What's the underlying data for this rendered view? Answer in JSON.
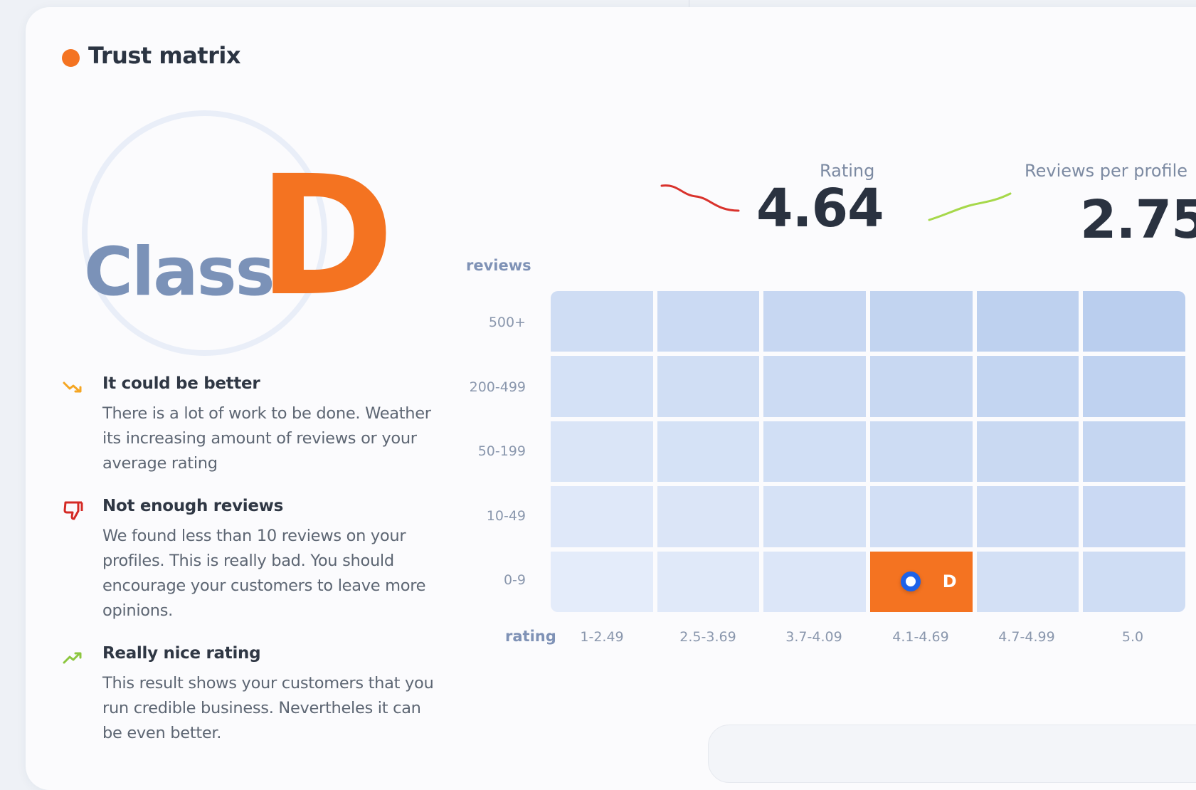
{
  "colors": {
    "accent": "#f47321",
    "class_word": "#7b92b8",
    "trend_down": "#d9322c",
    "trend_up": "#a6d84a",
    "marker": "#1e62e8",
    "grid_base": "#d1def3"
  },
  "title": "Trust matrix",
  "grade": {
    "word": "Class",
    "letter": "D"
  },
  "insights": [
    {
      "icon": "trend-down-icon",
      "title": "It could be better",
      "body": "There is a lot of work to be done. Weather its increasing amount of reviews or your average rating"
    },
    {
      "icon": "thumbs-down-icon",
      "title": "Not enough reviews",
      "body": "We found less than 10 reviews on your profiles. This is really bad. You should encourage your customers to leave more opinions."
    },
    {
      "icon": "trend-up-icon",
      "title": "Really nice rating",
      "body": "This result shows your customers that you run credible business. Nevertheles it can be even better."
    }
  ],
  "metrics": {
    "rating": {
      "label": "Rating",
      "value": "4.64",
      "trend": "down"
    },
    "reviews_per_profile": {
      "label": "Reviews per profile",
      "value": "2.75",
      "trend": "up"
    }
  },
  "matrix": {
    "y_title": "reviews",
    "x_title": "rating",
    "rows": [
      "500+",
      "200-499",
      "50-199",
      "10-49",
      "0-9"
    ],
    "cols": [
      "1-2.49",
      "2.5-3.69",
      "3.7-4.09",
      "4.1-4.69",
      "4.7-4.99",
      "5.0"
    ],
    "active": {
      "row": 4,
      "col": 3,
      "label": "D"
    }
  }
}
